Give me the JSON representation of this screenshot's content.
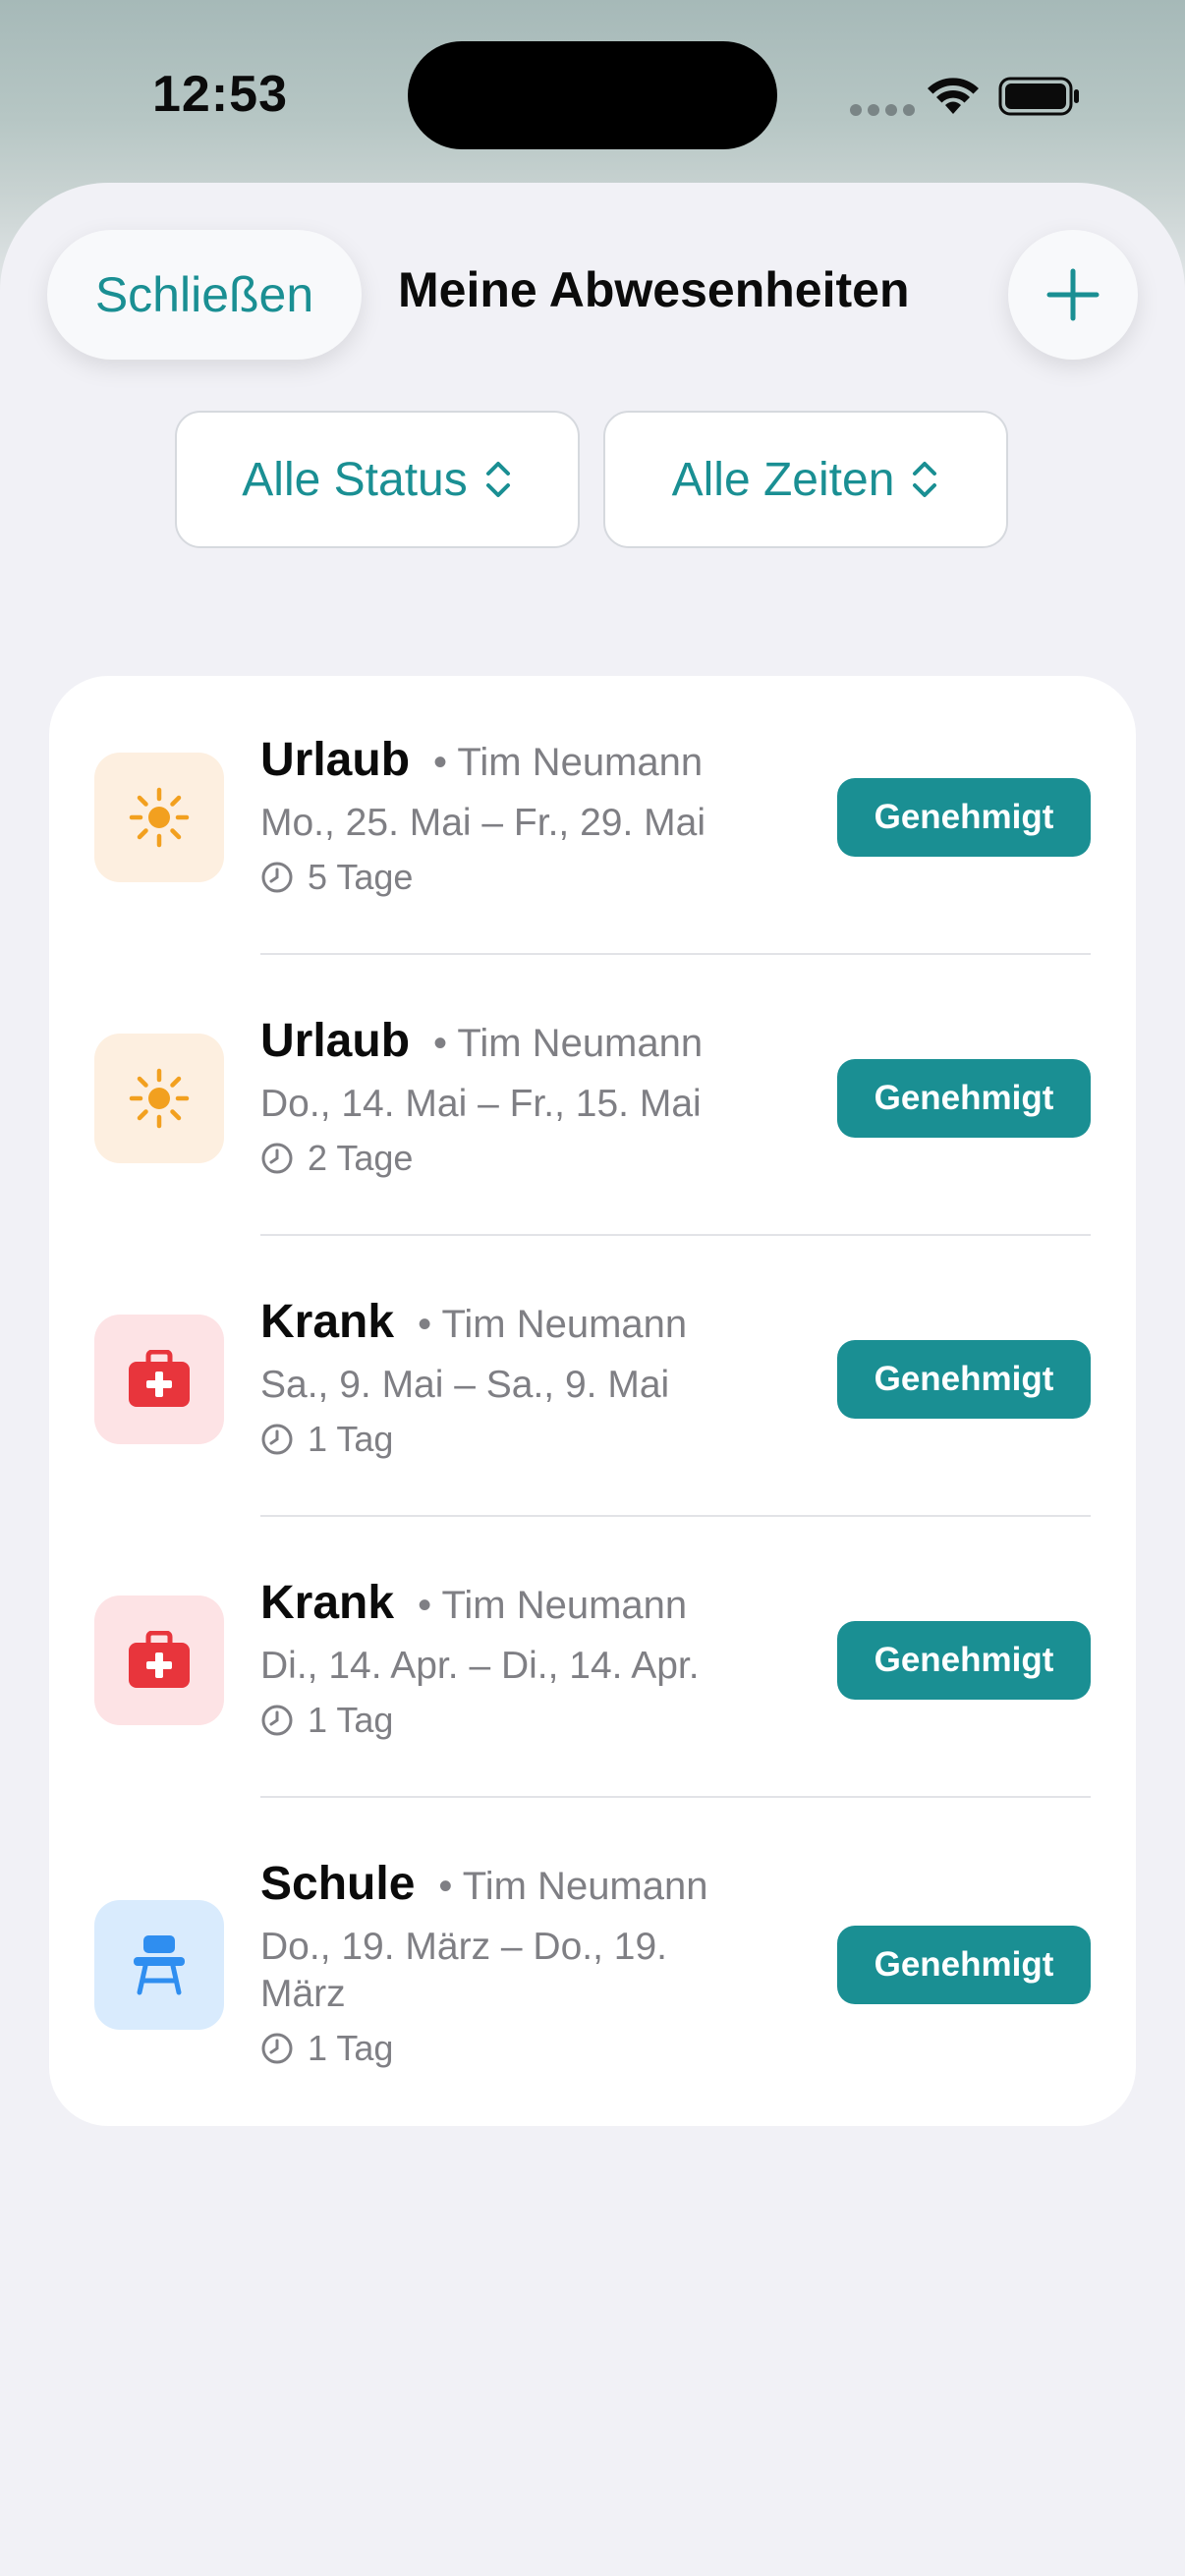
{
  "status_bar": {
    "time": "12:53"
  },
  "header": {
    "close_label": "Schließen",
    "title": "Meine Abwesenheiten"
  },
  "filters": {
    "status_label": "Alle Status",
    "time_label": "Alle Zeiten"
  },
  "colors": {
    "accent": "#1a8f93",
    "vacation_bg": "#fdefe0",
    "vacation_icon": "#f2a01f",
    "sick_bg": "#fde3e5",
    "sick_icon": "#e8353c",
    "school_bg": "#d9ebfd",
    "school_icon": "#2f8ef0"
  },
  "absences": [
    {
      "type": "Urlaub",
      "person": "• Tim Neumann",
      "dates": "Mo., 25. Mai – Fr., 29. Mai",
      "duration": "5 Tage",
      "status": "Genehmigt",
      "icon": "sun-icon"
    },
    {
      "type": "Urlaub",
      "person": "• Tim Neumann",
      "dates": "Do., 14. Mai – Fr., 15. Mai",
      "duration": "2 Tage",
      "status": "Genehmigt",
      "icon": "sun-icon"
    },
    {
      "type": "Krank",
      "person": "• Tim Neumann",
      "dates": "Sa., 9. Mai – Sa., 9. Mai",
      "duration": "1 Tag",
      "status": "Genehmigt",
      "icon": "medical-bag-icon"
    },
    {
      "type": "Krank",
      "person": "• Tim Neumann",
      "dates": "Di., 14. Apr. – Di., 14. Apr.",
      "duration": "1 Tag",
      "status": "Genehmigt",
      "icon": "medical-bag-icon"
    },
    {
      "type": "Schule",
      "person": "• Tim Neumann",
      "dates": "Do., 19. März – Do., 19. März",
      "duration": "1 Tag",
      "status": "Genehmigt",
      "icon": "school-desk-icon"
    }
  ]
}
